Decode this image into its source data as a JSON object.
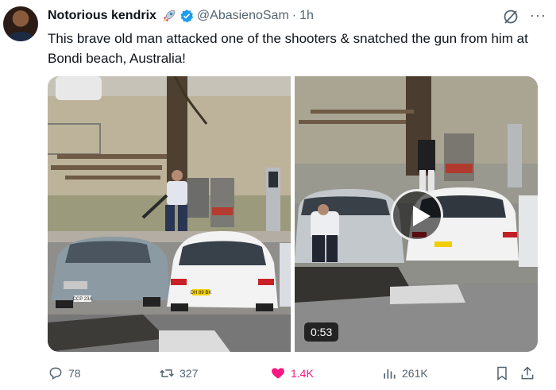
{
  "author": {
    "name": "Notorious kendrix",
    "handle": "@AbasienoSam",
    "separator": "·",
    "time": "1h",
    "icons": [
      "rocket-emoji-icon",
      "verified-badge-icon"
    ]
  },
  "tweet": {
    "text": "This brave old man attacked one of the shooters & snatched the gun from him at Bondi beach, Australia!"
  },
  "media": {
    "video_duration": "0:53",
    "plate_left_car_1": "CCP 23A",
    "plate_left_car_2": "DH 89 BK"
  },
  "header_icons": [
    "grok-icon",
    "more-icon"
  ],
  "actions": {
    "replies": "78",
    "reposts": "327",
    "likes": "1.4K",
    "views": "261K"
  },
  "colors": {
    "text": "#0f1419",
    "secondary": "#536471",
    "like": "#f91880",
    "verified": "#1d9bf0"
  }
}
